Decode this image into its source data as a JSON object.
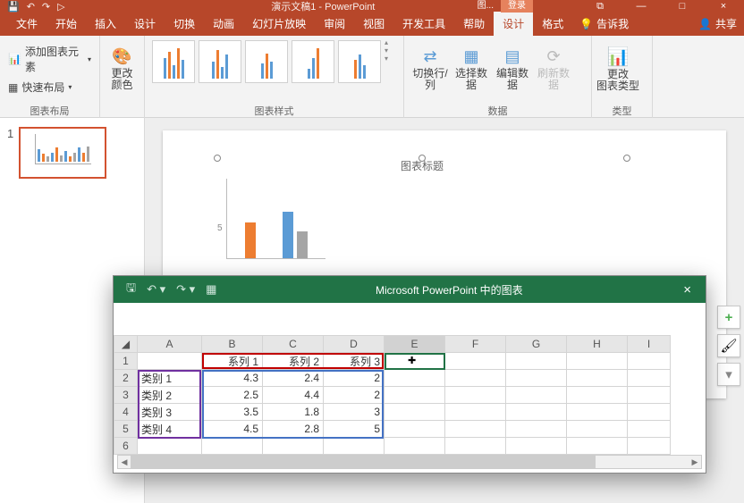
{
  "titlebar": {
    "doc_title": "演示文稿1 - PowerPoint",
    "ctx_tool": "图...",
    "login": "登录",
    "min": "—",
    "max": "□",
    "close": "×"
  },
  "tabs": {
    "file": "文件",
    "home": "开始",
    "insert": "插入",
    "design": "设计",
    "transition": "切换",
    "animation": "动画",
    "slideshow": "幻灯片放映",
    "review": "审阅",
    "view": "视图",
    "dev": "开发工具",
    "help": "帮助",
    "chartdesign": "设计",
    "format": "格式",
    "tellme": "告诉我",
    "share": "共享"
  },
  "ribbon": {
    "layout": {
      "add_element": "添加图表元素",
      "quick_layout": "快速布局",
      "group": "图表布局"
    },
    "colors": {
      "change_colors": "更改\n颜色"
    },
    "styles": {
      "group": "图表样式"
    },
    "data": {
      "switch": "切换行/列",
      "select": "选择数据",
      "edit": "编辑数\n据",
      "refresh": "刷新数据",
      "group": "数据"
    },
    "type": {
      "change_type": "更改\n图表类型",
      "group": "类型"
    }
  },
  "thumb": {
    "num": "1"
  },
  "chart": {
    "title": "图表标题",
    "ytick": "5"
  },
  "sidebtns": {
    "plus": "+",
    "brush": "🖌",
    "filter": "▾"
  },
  "sheet": {
    "title": "Microsoft PowerPoint 中的图表",
    "cols": [
      "A",
      "B",
      "C",
      "D",
      "E",
      "F",
      "G",
      "H",
      "I"
    ],
    "rows": [
      "1",
      "2",
      "3",
      "4",
      "5",
      "6"
    ],
    "headers": {
      "b": "系列 1",
      "c": "系列 2",
      "d": "系列 3"
    },
    "data": [
      {
        "cat": "类别 1",
        "b": "4.3",
        "c": "2.4",
        "d": "2"
      },
      {
        "cat": "类别 2",
        "b": "2.5",
        "c": "4.4",
        "d": "2"
      },
      {
        "cat": "类别 3",
        "b": "3.5",
        "c": "1.8",
        "d": "3"
      },
      {
        "cat": "类别 4",
        "b": "4.5",
        "c": "2.8",
        "d": "5"
      }
    ]
  },
  "chart_data": {
    "type": "bar",
    "title": "图表标题",
    "categories": [
      "类别 1",
      "类别 2",
      "类别 3",
      "类别 4"
    ],
    "series": [
      {
        "name": "系列 1",
        "values": [
          4.3,
          2.5,
          3.5,
          4.5
        ]
      },
      {
        "name": "系列 2",
        "values": [
          2.4,
          4.4,
          1.8,
          2.8
        ]
      },
      {
        "name": "系列 3",
        "values": [
          2,
          2,
          3,
          5
        ]
      }
    ],
    "ylim": [
      0,
      6
    ]
  }
}
